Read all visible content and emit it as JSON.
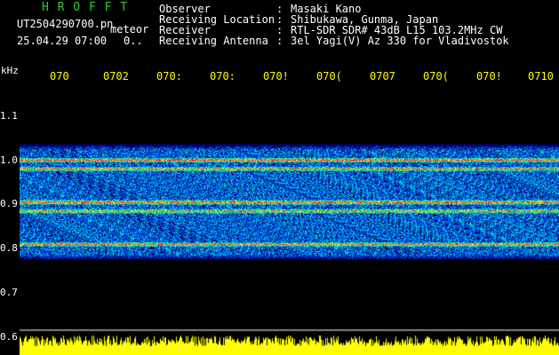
{
  "header": {
    "app_title": "H R O F F T",
    "filename": "UT2504290700.pn",
    "tag": "meteor",
    "datetime": "25.04.29 07:00",
    "status": "0.."
  },
  "info": [
    {
      "label": "Observer",
      "value": "Masaki Kano"
    },
    {
      "label": "Receiving Location",
      "value": "Shibukawa, Gunma, Japan"
    },
    {
      "label": "Receiver",
      "value": "RTL-SDR SDR# 43dB L15 103.2MHz CW"
    },
    {
      "label": "Receiving Antenna",
      "value": "3el Yagi(V) Az 330 for Vladivostok"
    }
  ],
  "axes": {
    "y_unit": "kHz",
    "y_ticks": [
      "1.1",
      "1.0",
      "0.9",
      "0.8",
      "0.7",
      "0.6"
    ],
    "x_ticks": [
      "070",
      "0702",
      "070:",
      "070:",
      "070!",
      "070(",
      "0707",
      "070(",
      "070!",
      "0710"
    ]
  },
  "colors": {
    "background": "#000000",
    "title": "#2bd12b",
    "text": "#ffffff",
    "time_ticks": "#ffff00",
    "signal_bar": "#ffff00"
  },
  "chart_data": {
    "type": "heatmap",
    "x_ticks": [
      "070",
      "0702",
      "070:",
      "070:",
      "070!",
      "070(",
      "0707",
      "070(",
      "070!",
      "0710"
    ],
    "y_ticks": [
      1.1,
      1.0,
      0.9,
      0.8,
      0.7,
      0.6
    ],
    "ylabel": "kHz",
    "ylim": [
      0.6,
      1.1
    ],
    "band_range_khz": [
      0.775,
      1.035
    ],
    "strong_lines_khz": [
      1.0,
      0.98,
      0.905,
      0.885,
      0.81
    ],
    "signal_bar": true
  }
}
